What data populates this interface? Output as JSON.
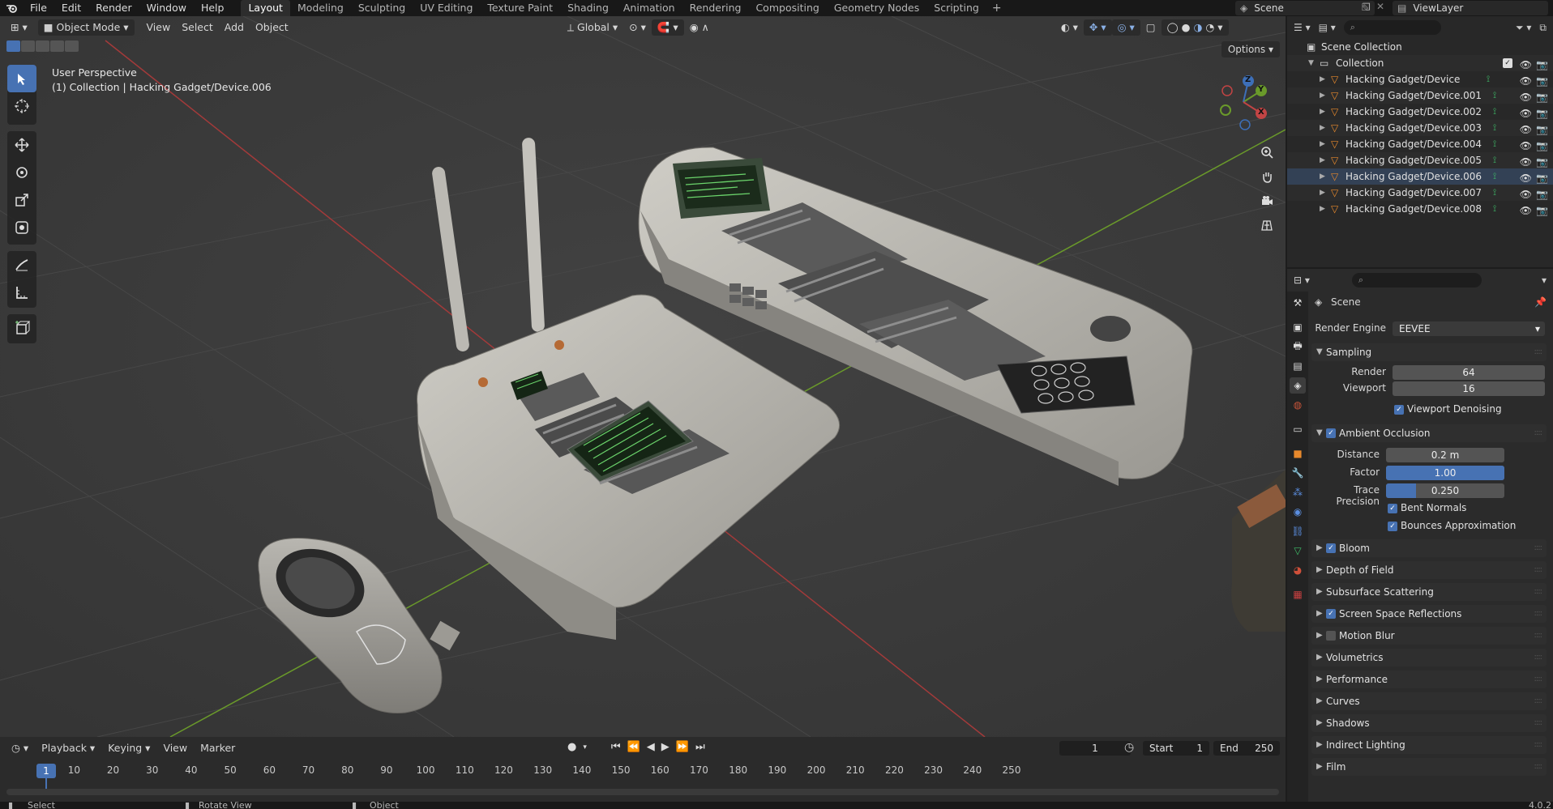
{
  "topbar": {
    "menus": [
      "File",
      "Edit",
      "Render",
      "Window",
      "Help"
    ],
    "workspaces": [
      "Layout",
      "Modeling",
      "Sculpting",
      "UV Editing",
      "Texture Paint",
      "Shading",
      "Animation",
      "Rendering",
      "Compositing",
      "Geometry Nodes",
      "Scripting"
    ],
    "active_workspace": "Layout",
    "scene": "Scene",
    "view_layer": "ViewLayer"
  },
  "viewport": {
    "mode": "Object Mode",
    "menus": [
      "View",
      "Select",
      "Add",
      "Object"
    ],
    "transform_orientation": "Global",
    "options_label": "Options",
    "info_line1": "User Perspective",
    "info_line2": "(1) Collection | Hacking Gadget/Device.006",
    "gizmo_axes": [
      "X",
      "Y",
      "Z"
    ]
  },
  "outliner": {
    "root": "Scene Collection",
    "collection": "Collection",
    "objects": [
      "Hacking Gadget/Device",
      "Hacking Gadget/Device.001",
      "Hacking Gadget/Device.002",
      "Hacking Gadget/Device.003",
      "Hacking Gadget/Device.004",
      "Hacking Gadget/Device.005",
      "Hacking Gadget/Device.006",
      "Hacking Gadget/Device.007",
      "Hacking Gadget/Device.008"
    ]
  },
  "properties": {
    "context": "Scene",
    "render_engine_label": "Render Engine",
    "render_engine": "EEVEE",
    "sampling": {
      "title": "Sampling",
      "render_label": "Render",
      "render_value": "64",
      "viewport_label": "Viewport",
      "viewport_value": "16",
      "denoise_label": "Viewport Denoising"
    },
    "ao": {
      "title": "Ambient Occlusion",
      "distance_label": "Distance",
      "distance_value": "0.2 m",
      "factor_label": "Factor",
      "factor_value": "1.00",
      "factor_fraction": 1.0,
      "trace_label": "Trace Precision",
      "trace_value": "0.250",
      "trace_fraction": 0.25,
      "bent_normals": "Bent Normals",
      "bounces": "Bounces Approximation"
    },
    "panels": [
      {
        "title": "Bloom",
        "checkbox": true,
        "checked": true
      },
      {
        "title": "Depth of Field",
        "checkbox": false
      },
      {
        "title": "Subsurface Scattering",
        "checkbox": false
      },
      {
        "title": "Screen Space Reflections",
        "checkbox": true,
        "checked": true
      },
      {
        "title": "Motion Blur",
        "checkbox": true,
        "checked": false
      },
      {
        "title": "Volumetrics",
        "checkbox": false
      },
      {
        "title": "Performance",
        "checkbox": false
      },
      {
        "title": "Curves",
        "checkbox": false
      },
      {
        "title": "Shadows",
        "checkbox": false
      },
      {
        "title": "Indirect Lighting",
        "checkbox": false
      },
      {
        "title": "Film",
        "checkbox": false
      }
    ]
  },
  "timeline": {
    "menus": [
      "Playback",
      "Keying",
      "View",
      "Marker"
    ],
    "current_frame": "1",
    "start_label": "Start",
    "start_value": "1",
    "end_label": "End",
    "end_value": "250",
    "ticks": [
      "10",
      "20",
      "30",
      "40",
      "50",
      "60",
      "70",
      "80",
      "90",
      "100",
      "110",
      "120",
      "130",
      "140",
      "150",
      "160",
      "170",
      "180",
      "190",
      "200",
      "210",
      "220",
      "230",
      "240",
      "250"
    ]
  },
  "statusbar": {
    "select": "Select",
    "rotate": "Rotate View",
    "object": "Object",
    "version": "4.0.2"
  },
  "colors": {
    "accent": "#4772b3",
    "viewport_bg": "#3b3b3b",
    "grid_x": "#a33a3a",
    "grid_y": "#6a9a2a"
  }
}
